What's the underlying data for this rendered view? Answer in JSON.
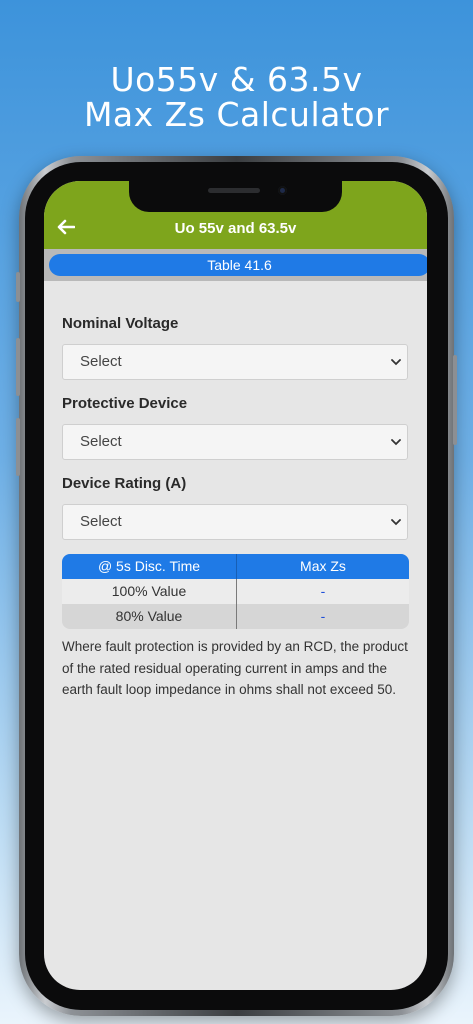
{
  "promo": {
    "title_line1": "Uo55v & 63.5v",
    "title_line2": "Max Zs Calculator"
  },
  "appbar": {
    "back_icon": "arrow-left-icon",
    "title": "Uo 55v and 63.5v"
  },
  "table_ref": "Table 41.6",
  "form": {
    "nominal_voltage": {
      "label": "Nominal Voltage",
      "value": "Select"
    },
    "protective_device": {
      "label": "Protective Device",
      "value": "Select"
    },
    "device_rating": {
      "label": "Device Rating (A)",
      "value": "Select"
    }
  },
  "results": {
    "headers": [
      "@ 5s Disc. Time",
      "Max Zs"
    ],
    "rows": [
      {
        "label": "100% Value",
        "value": "-"
      },
      {
        "label": "80% Value",
        "value": "-"
      }
    ]
  },
  "note": "Where fault protection is provided by an RCD, the product of the rated residual operating current in amps and the earth fault loop impedance in ohms shall not exceed 50.",
  "colors": {
    "appbar": "#7ea51c",
    "accent_blue": "#1f7ae6",
    "screen_bg": "#e6e6e6"
  }
}
